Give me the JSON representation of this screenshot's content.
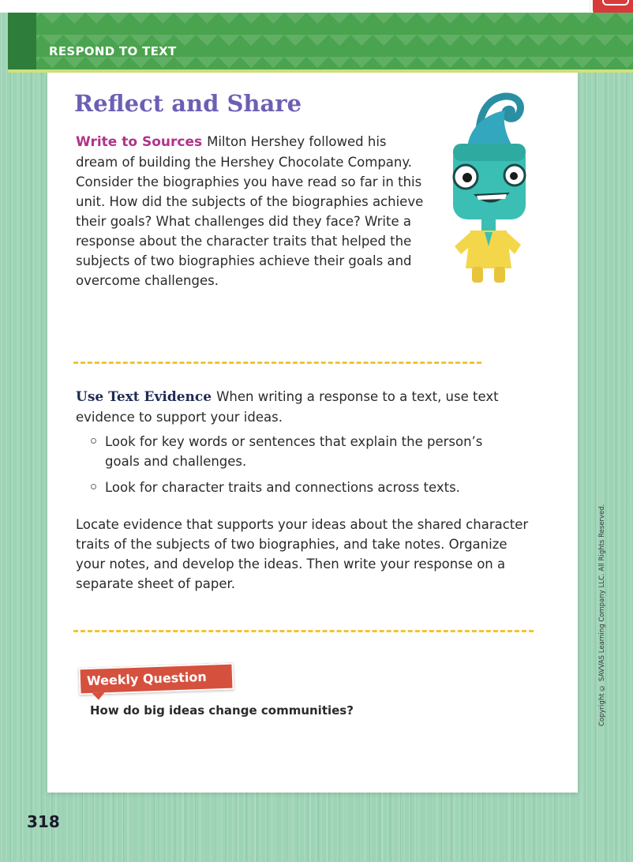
{
  "header": {
    "section_label": "RESPOND TO TEXT"
  },
  "card": {
    "title": "Reflect and Share",
    "write_to_sources": {
      "label": "Write to Sources",
      "text": "Milton Hershey followed his dream of building the Hershey Chocolate Company. Consider the biographies you have read so far in this unit. How did the subjects of the biographies achieve their goals? What challenges did they face? Write a response about the character traits that helped the subjects of two biographies achieve their goals and overcome challenges."
    },
    "use_text_evidence": {
      "label": "Use Text Evidence",
      "text": "When writing a response to a text, use text evidence to support your ideas.",
      "bullets": [
        "Look for key words or sentences that explain the person’s goals and challenges.",
        "Look for character traits and connections across texts."
      ],
      "closing": "Locate evidence that supports your ideas about the shared character traits of the subjects of two biographies, and take notes. Organize your notes, and develop the ideas. Then write your response on a separate sheet of paper."
    },
    "weekly_question": {
      "label": "Weekly Question",
      "text": "How do big ideas change communities?"
    }
  },
  "colors": {
    "title": "#6b5fb5",
    "write_to_sources_label": "#b0338a",
    "use_text_evidence_label": "#1f2a55",
    "banner_green": "#4aa34e",
    "background_green": "#9ed4b6",
    "weekly_badge": "#d6503e",
    "divider_yellow": "#f2c430"
  },
  "icons": {
    "mascot": "teal-cartoon-character-icon",
    "corner_tab": "red-corner-tab-icon",
    "bullet": "circle-bullet-icon"
  },
  "copyright": "Copyright © SAVVAS Learning Company LLC. All Rights Reserved.",
  "page_number": "318"
}
